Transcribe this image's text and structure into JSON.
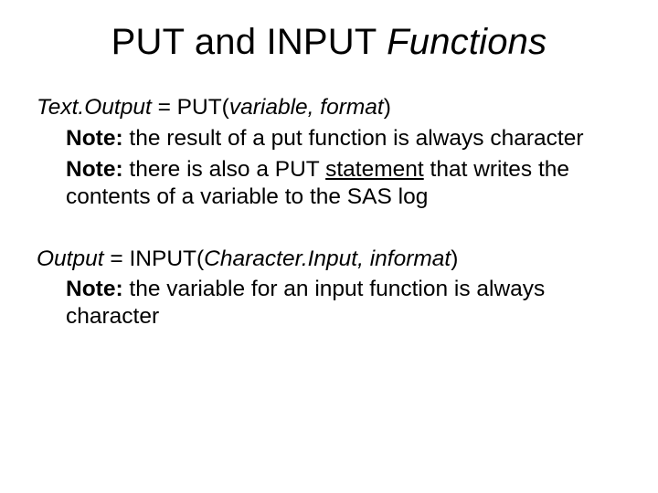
{
  "title": {
    "part1": "PUT and INPUT ",
    "part2_italic": "Functions"
  },
  "put": {
    "lhs_italic": "Text.Output",
    "eq": " = PUT(",
    "args_italic": "variable, format",
    "close": ")",
    "note1_label": "Note:",
    "note1_text": " the result of a put function is always character",
    "note2_label": "Note:",
    "note2_text_a": "  there is also a PUT ",
    "note2_underline": "statement",
    "note2_text_b": " that writes the contents of a variable to the SAS log"
  },
  "input": {
    "lhs_italic": "Output",
    "eq": " = INPUT(",
    "args_italic": "Character.Input, informat",
    "close": ")",
    "note1_label": "Note:",
    "note1_text": " the variable for an input function is always character"
  }
}
